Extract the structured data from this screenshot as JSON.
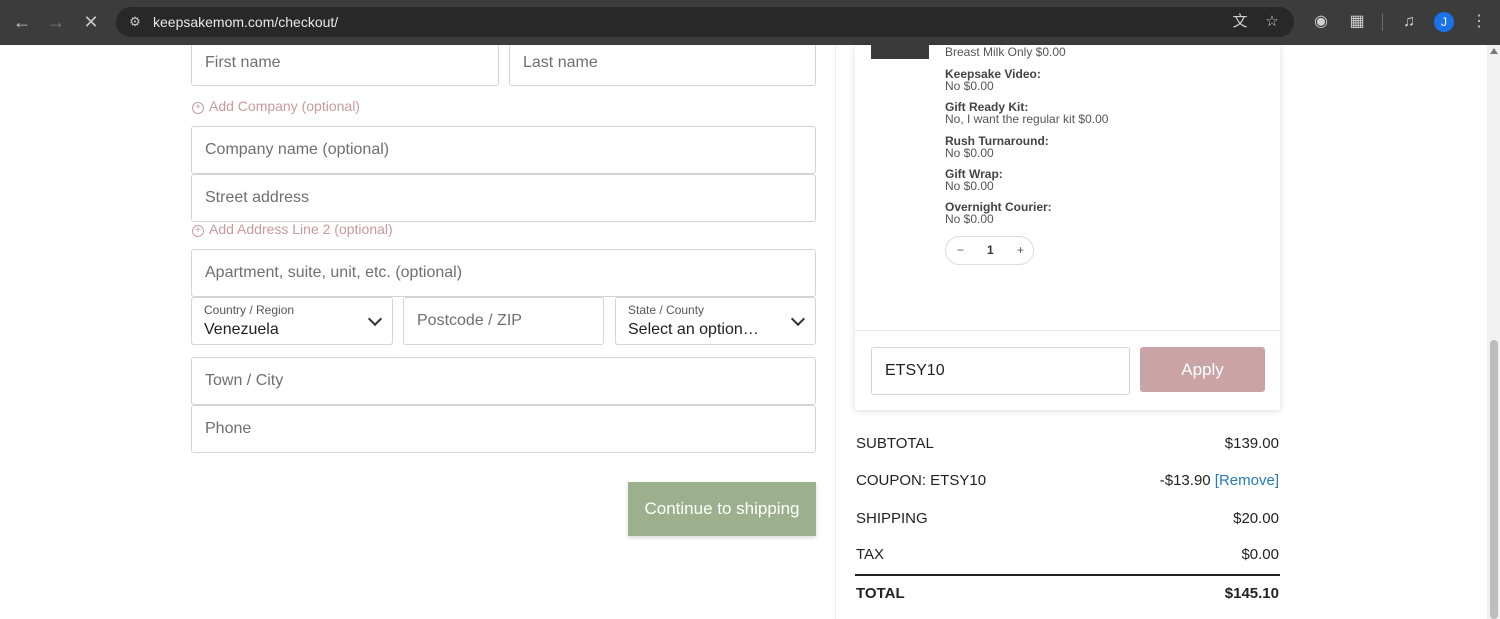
{
  "browser": {
    "url": "keepsakemom.com/checkout/",
    "profile_initial": "J"
  },
  "form": {
    "first_name_placeholder": "First name",
    "last_name_placeholder": "Last name",
    "add_company_label": "Add Company (optional)",
    "company_placeholder": "Company name (optional)",
    "street_placeholder": "Street address",
    "add_address2_label": "Add Address Line 2 (optional)",
    "apartment_placeholder": "Apartment, suite, unit, etc. (optional)",
    "country": {
      "label": "Country / Region",
      "value": "Venezuela"
    },
    "postcode_placeholder": "Postcode / ZIP",
    "state": {
      "label": "State / County",
      "value": "Select an option…"
    },
    "town_placeholder": "Town / City",
    "phone_placeholder": "Phone",
    "continue_label": "Continue to shipping"
  },
  "cart": {
    "first_option_text": "Breast Milk Only $0.00",
    "options": [
      {
        "name": "Keepsake Video:",
        "value": "No $0.00"
      },
      {
        "name": "Gift Ready Kit:",
        "value": "No, I want the regular kit $0.00"
      },
      {
        "name": "Rush Turnaround:",
        "value": "No $0.00"
      },
      {
        "name": "Gift Wrap:",
        "value": "No $0.00"
      },
      {
        "name": "Overnight Courier:",
        "value": "No $0.00"
      }
    ],
    "quantity": {
      "minus": "−",
      "value": "1",
      "plus": "+"
    },
    "coupon_value": "ETSY10",
    "apply_label": "Apply"
  },
  "summary": {
    "subtotal": {
      "label": "SUBTOTAL",
      "value": "$139.00"
    },
    "coupon": {
      "label": "COUPON: ETSY10",
      "value": "-$13.90",
      "remove": "[Remove]"
    },
    "shipping": {
      "label": "SHIPPING",
      "value": "$20.00"
    },
    "tax": {
      "label": "TAX",
      "value": "$0.00"
    },
    "total": {
      "label": "TOTAL",
      "value": "$145.10"
    }
  }
}
